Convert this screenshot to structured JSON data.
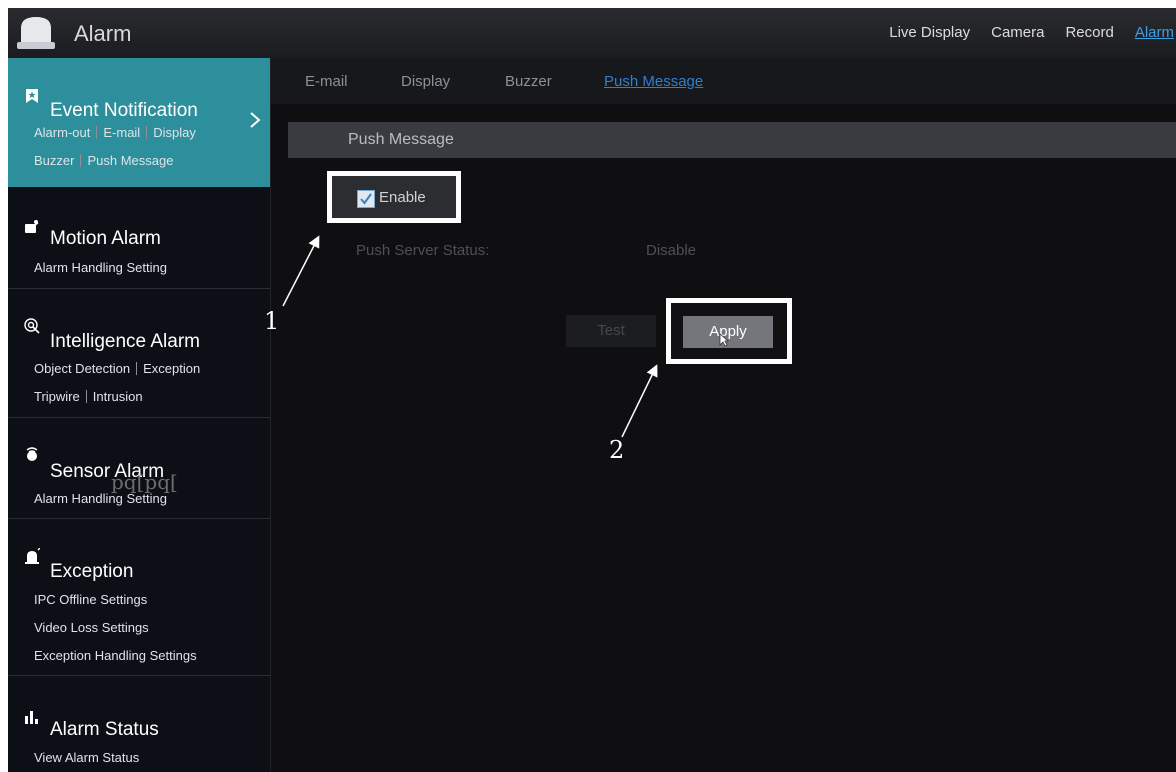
{
  "header": {
    "title": "Alarm",
    "nav": [
      "Live Display",
      "Camera",
      "Record",
      "Alarm"
    ],
    "active_nav": "Alarm"
  },
  "sidebar": {
    "groups": [
      {
        "title": "Event Notification",
        "icon": "bookmark-star-icon",
        "lines": [
          [
            "Alarm-out",
            "E-mail",
            "Display"
          ],
          [
            "Buzzer",
            "Push Message"
          ]
        ]
      },
      {
        "title": "Motion Alarm",
        "icon": "motion-running-icon",
        "lines": [
          [
            "Alarm Handling Setting"
          ]
        ]
      },
      {
        "title": "Intelligence Alarm",
        "icon": "intelligence-target-icon",
        "lines": [
          [
            "Object Detection",
            "Exception"
          ],
          [
            "Tripwire",
            "Intrusion"
          ]
        ]
      },
      {
        "title": "Sensor Alarm",
        "icon": "sensor-icon",
        "lines": [
          [
            "Alarm Handling Setting"
          ]
        ]
      },
      {
        "title": "Exception",
        "icon": "siren-icon",
        "lines": [
          [
            "IPC Offline Settings"
          ],
          [
            "Video Loss Settings"
          ],
          [
            "Exception Handling Settings"
          ]
        ]
      },
      {
        "title": "Alarm Status",
        "icon": "bar-status-icon",
        "lines": [
          [
            "View Alarm Status"
          ]
        ]
      }
    ],
    "watermark": "pq[pq["
  },
  "tabs": [
    "E-mail",
    "Display",
    "Buzzer",
    "Push Message"
  ],
  "active_tab": "Push Message",
  "section": {
    "title": "Push Message"
  },
  "form": {
    "enable_label": "Enable",
    "enable_checked": true,
    "status_label": "Push Server Status:",
    "status_value": "Disable"
  },
  "buttons": {
    "test": "Test",
    "apply": "Apply"
  },
  "annotations": {
    "step1": "1",
    "step2": "2"
  },
  "colors": {
    "accent_teal": "#2c8f9b",
    "nav_active": "#3f9fe3",
    "tab_active": "#2f7fd0"
  }
}
